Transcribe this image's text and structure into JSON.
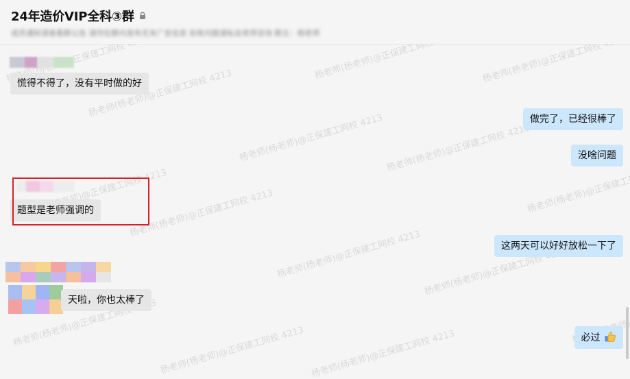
{
  "header": {
    "title": "24年造价VIP全科③群",
    "subtitle": "成员通知请查看群公告 请勿在群内发布无关广告信息 如有问题请私信老师咨询 群主：杨老师"
  },
  "watermark": "杨老师(杨老师)@正保建工网校 4213",
  "messages": [
    {
      "side": "in",
      "text": "慌得不得了，没有平时做的好"
    },
    {
      "side": "out",
      "text": "做完了，已经很棒了"
    },
    {
      "side": "out",
      "text": "没啥问题"
    },
    {
      "side": "in",
      "text": "题型是老师强调的"
    },
    {
      "side": "out",
      "text": "这两天可以好好放松一下了"
    },
    {
      "side": "in",
      "text": "天啦，你也太棒了"
    },
    {
      "side": "out",
      "text": "必过"
    }
  ],
  "icons": {
    "lock": "lock-icon",
    "thumbs_up": "thumbs-up-icon"
  },
  "colors": {
    "incoming_bubble": "#e6e6e6",
    "outgoing_bubble": "#cce6fc",
    "highlight_box": "#d7202a"
  }
}
